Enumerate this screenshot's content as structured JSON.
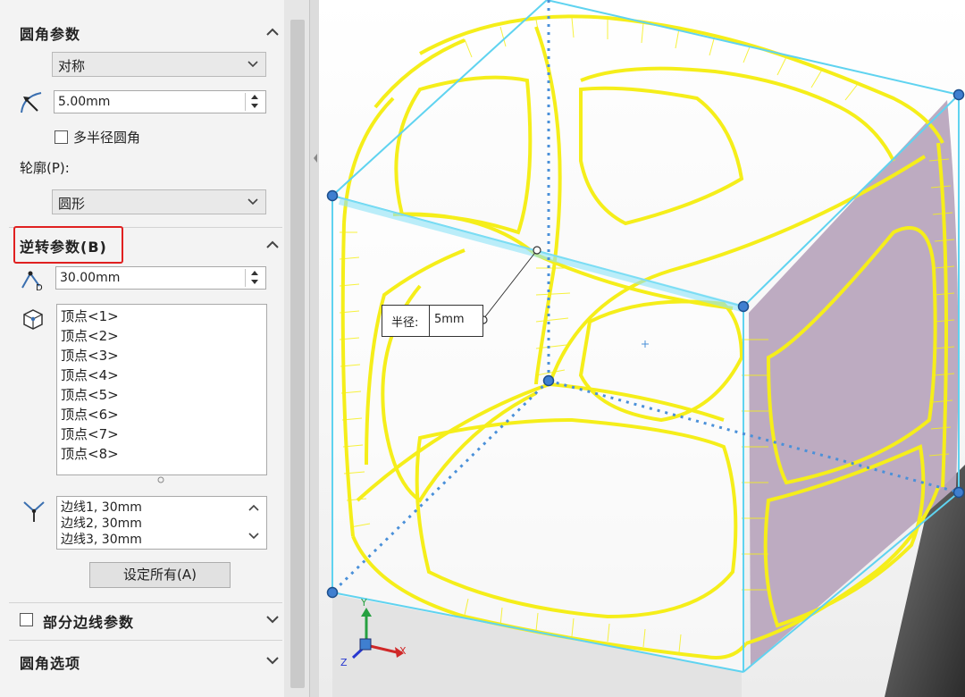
{
  "fillet_params": {
    "title": "圆角参数",
    "type_value": "对称",
    "radius": "5.00mm",
    "multi_radius_label": "多半径圆角",
    "profile_label": "轮廓(P):",
    "profile_value": "圆形"
  },
  "setback_params": {
    "title": "逆转参数(B)",
    "distance": "30.00mm",
    "vertices": [
      "顶点<1>",
      "顶点<2>",
      "顶点<3>",
      "顶点<4>",
      "顶点<5>",
      "顶点<6>",
      "顶点<7>",
      "顶点<8>"
    ],
    "edges": [
      "边线1, 30mm",
      "边线2, 30mm",
      "边线3, 30mm"
    ],
    "set_all_label": "设定所有(A)"
  },
  "partial_edge": {
    "title": "部分边线参数"
  },
  "fillet_options": {
    "title": "圆角选项"
  },
  "viewport": {
    "radius_callout_label": "半径:",
    "radius_callout_value": "5mm",
    "axes": {
      "x": "X",
      "y": "Y",
      "z": "Z"
    }
  },
  "colors": {
    "highlight": "#e02020",
    "fillet_wire": "#f5ee1a",
    "box_edge": "#5fd3f0",
    "selected_face": "#b9a6be",
    "point": "#3f7fd0"
  }
}
